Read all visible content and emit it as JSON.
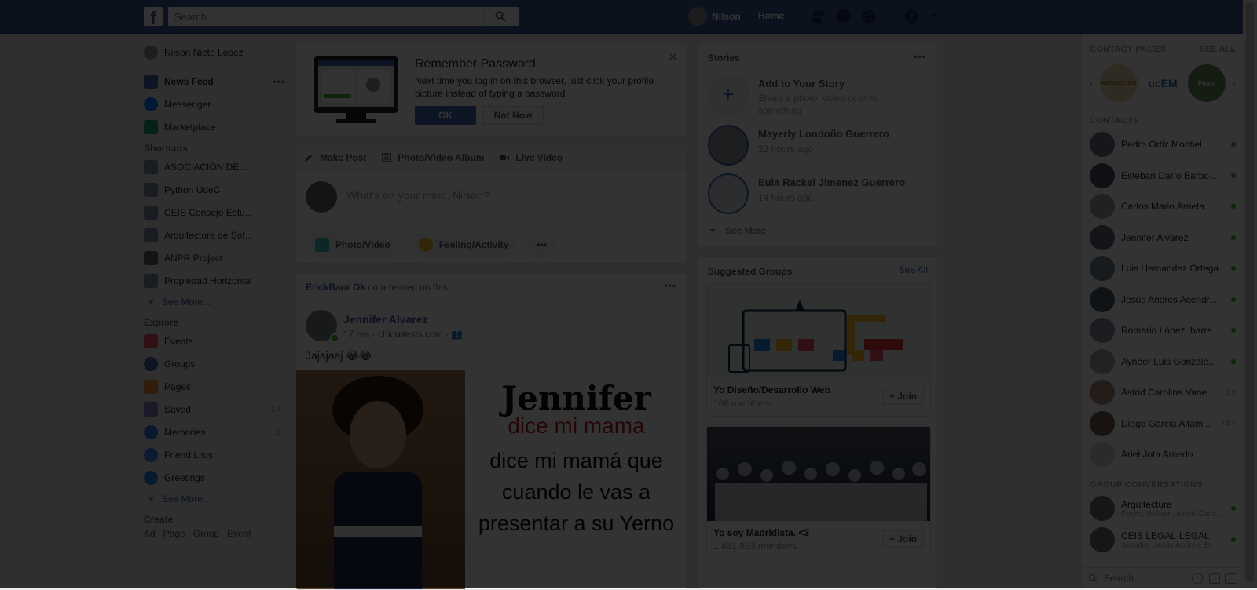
{
  "colors": {
    "brand": "#3b5998",
    "link": "#385898",
    "overlay": "rgba(0,0,0,0.8)",
    "online": "#42b72a"
  },
  "topbar": {
    "search_placeholder": "Search",
    "user_name": "Nilson",
    "home_label": "Home",
    "icons": [
      "friend-requests-icon",
      "messenger-icon",
      "notifications-icon",
      "help-icon",
      "account-menu-icon"
    ]
  },
  "leftnav": {
    "profile_name": "Nilson Nieto Lopez",
    "items": [
      {
        "label": "News Feed",
        "icon": "news-feed-icon"
      },
      {
        "label": "Messenger",
        "icon": "messenger-icon"
      },
      {
        "label": "Marketplace",
        "icon": "marketplace-icon"
      }
    ],
    "shortcuts_header": "Shortcuts",
    "shortcuts": [
      {
        "label": "ASOCIACIÓN DE..."
      },
      {
        "label": "Python UdeC"
      },
      {
        "label": "CEIS Consejo Estu..."
      },
      {
        "label": "Arquitectura de Sof..."
      },
      {
        "label": "ANPR Project"
      },
      {
        "label": "Propiedad Horizontal"
      }
    ],
    "see_more": "See More...",
    "explore_header": "Explore",
    "explore": [
      {
        "label": "Events",
        "count": ""
      },
      {
        "label": "Groups",
        "count": ""
      },
      {
        "label": "Pages",
        "count": ""
      },
      {
        "label": "Saved",
        "count": "14"
      },
      {
        "label": "Memories",
        "count": "1"
      },
      {
        "label": "Friend Lists",
        "count": ""
      },
      {
        "label": "Greetings",
        "count": ""
      }
    ],
    "explore_see_more": "See More...",
    "create_header": "Create",
    "create_links": [
      "Ad",
      "Page",
      "Group",
      "Event"
    ]
  },
  "remember_password": {
    "title": "Remember Password",
    "text": "Next time you log in on this browser, just click your profile picture instead of typing a password",
    "ok": "OK",
    "not_now": "Not Now"
  },
  "composer": {
    "tabs": [
      "Make Post",
      "Photo/Video Album",
      "Live Video"
    ],
    "placeholder": "What's on your mind, Nilson?",
    "buttons": [
      "Photo/Video",
      "Feeling/Activity"
    ],
    "more": "•••"
  },
  "post": {
    "activity_actor": "ErickBaor Ok",
    "activity_text": "commented on this.",
    "author": "Jennifer Alvarez",
    "meta": "17 hrs · chiquitests.com ·",
    "text": "Jajajaaj 😂😂",
    "image_title": "Jennifer",
    "image_subtitle": "dice mi mama",
    "image_body": "dice mi mamá que cuando le vas a presentar a su Yerno"
  },
  "stories": {
    "title": "Stories",
    "add_title": "Add to Your Story",
    "add_desc": "Share a photo, video or write something",
    "items": [
      {
        "name": "Mayerly Londoño Guerrero",
        "time": "22 hours ago"
      },
      {
        "name": "Eula Rackel Jimenez Guerrero",
        "time": "14 hours ago"
      }
    ],
    "see_more": "See More"
  },
  "suggested_groups": {
    "title": "Suggested Groups",
    "see_all": "See All",
    "items": [
      {
        "name": "Yo Diseño/Desarrollo Web",
        "members": "166 members",
        "join": "+ Join"
      },
      {
        "name": "Yo soy Madridista. <3",
        "members": "1,481,853 members",
        "join": "+ Join"
      }
    ]
  },
  "chat": {
    "contact_pages_header": "CONTACT PAGES",
    "see_all": "SEE ALL",
    "contact_pages": [
      "ASOCIACIÓN",
      "ucEM",
      "Photo"
    ],
    "contacts_header": "CONTACTS",
    "contacts": [
      {
        "name": "Pedro Ortiz Montiel",
        "status": "online",
        "idle": ""
      },
      {
        "name": "Esteban Darío Barbo...",
        "status": "online",
        "idle": ""
      },
      {
        "name": "Carlos Mario Arrieta ...",
        "status": "online",
        "idle": ""
      },
      {
        "name": "Jennifer Alvarez",
        "status": "online",
        "idle": ""
      },
      {
        "name": "Luis Hernandez Ortega",
        "status": "online",
        "idle": ""
      },
      {
        "name": "Jesús Andrés Acendr...",
        "status": "online",
        "idle": ""
      },
      {
        "name": "Romario López Ibarra",
        "status": "online",
        "idle": ""
      },
      {
        "name": "Ayneer Luis Gonzale...",
        "status": "online",
        "idle": ""
      },
      {
        "name": "Astrid Carolina Vane...",
        "status": "idle",
        "idle": "2m"
      },
      {
        "name": "Diego García Altam...",
        "status": "idle",
        "idle": "43m"
      },
      {
        "name": "Ariel Jota Arnedo",
        "status": "none",
        "idle": ""
      }
    ],
    "group_conversations_header": "GROUP CONVERSATIONS",
    "group_conversations": [
      {
        "name": "Arquitectura",
        "members": "Pedro, William, Astrid Caro..."
      },
      {
        "name": "CEIS LEGAL-LEGAL",
        "members": "Jennifer, Jesús Andrés, Er..."
      }
    ],
    "search_placeholder": "Search"
  }
}
